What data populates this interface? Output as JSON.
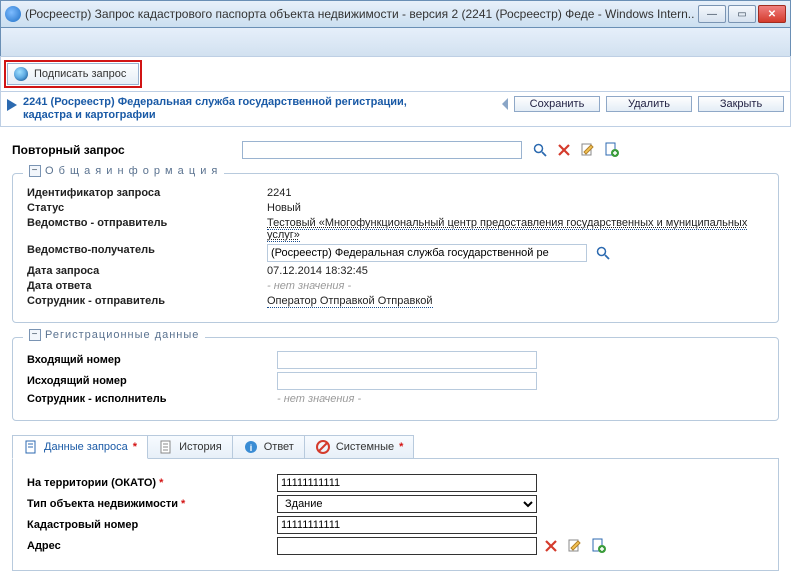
{
  "window": {
    "title": "(Росреестр) Запрос кадастрового паспорта объекта недвижимости - версия 2 (2241 (Росреестр) Феде - Windows Intern..."
  },
  "toolbar": {
    "sign_label": "Подписать запрос"
  },
  "header": {
    "title": "2241 (Росреестр) Федеральная служба государственной регистрации, кадастра и картографии",
    "save": "Сохранить",
    "delete": "Удалить",
    "close": "Закрыть"
  },
  "repeat": {
    "label": "Повторный запрос",
    "value": ""
  },
  "general": {
    "legend": "О б щ а я   и н ф о р м а ц и я",
    "id_label": "Идентификатор запроса",
    "id_value": "2241",
    "status_label": "Статус",
    "status_value": "Новый",
    "sender_label": "Ведомство - отправитель",
    "sender_value": "Тестовый «Многофункциональный центр предоставления государственных и муниципальных услуг»",
    "receiver_label": "Ведомство-получатель",
    "receiver_value": "(Росреестр) Федеральная служба государственной ре",
    "req_date_label": "Дата запроса",
    "req_date_value": "07.12.2014 18:32:45",
    "ans_date_label": "Дата ответа",
    "ans_date_value": "- нет значения -",
    "emp_label": "Сотрудник - отправитель",
    "emp_value": "Оператор Отправкой Отправкой"
  },
  "reg": {
    "legend": "Регистрационные данные",
    "in_no_label": "Входящий номер",
    "in_no_value": "",
    "out_no_label": "Исходящий номер",
    "out_no_value": "",
    "executor_label": "Сотрудник - исполнитель",
    "executor_value": "- нет значения -"
  },
  "tabs": {
    "data": "Данные запроса",
    "history": "История",
    "answer": "Ответ",
    "system": "Системные"
  },
  "form": {
    "okato_label": "На территории (ОКАТО)",
    "okato_value": "11111111111",
    "objtype_label": "Тип объекта недвижимости",
    "objtype_value": "Здание",
    "cadno_label": "Кадастровый номер",
    "cadno_value": "11111111111",
    "addr_label": "Адрес",
    "addr_value": ""
  }
}
